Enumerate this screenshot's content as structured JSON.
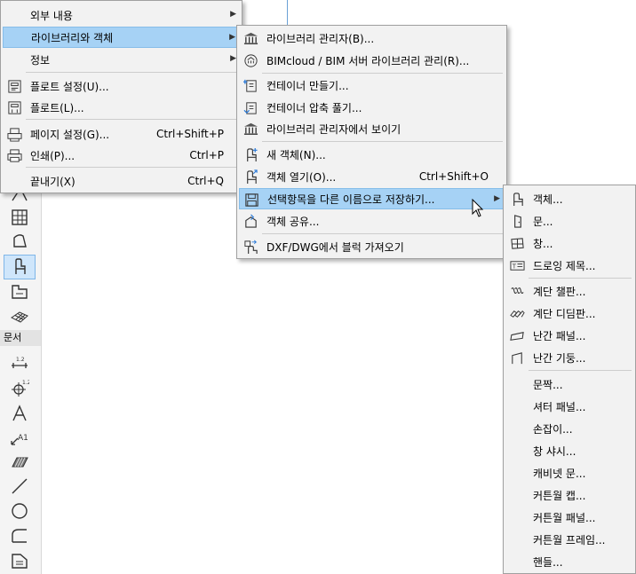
{
  "toolbox": {
    "section_label": "문서",
    "tools": [
      {
        "name": "door-tool-icon"
      },
      {
        "name": "curtain-wall-tool-icon"
      },
      {
        "name": "shell-tool-icon"
      },
      {
        "name": "object-tool-icon",
        "active": true
      },
      {
        "name": "zone-tool-icon"
      },
      {
        "name": "mesh-tool-icon"
      },
      {
        "name": "dimension-tool-icon"
      },
      {
        "name": "level-dimension-tool-icon"
      },
      {
        "name": "text-tool-icon"
      },
      {
        "name": "label-tool-icon"
      },
      {
        "name": "fill-tool-icon"
      },
      {
        "name": "line-tool-icon"
      },
      {
        "name": "circle-tool-icon"
      },
      {
        "name": "polyline-tool-icon"
      },
      {
        "name": "drawing-tool-icon"
      }
    ]
  },
  "file_menu": {
    "items": [
      {
        "label": "외부 내용",
        "submenu": true
      },
      {
        "label": "라이브러리와 객체",
        "submenu": true,
        "highlighted": true
      },
      {
        "label": "정보",
        "submenu": true
      },
      {
        "label": "플로트 설정(U)...",
        "icon": "plot-setup-icon"
      },
      {
        "label": "플로트(L)...",
        "icon": "plot-icon"
      },
      {
        "label": "페이지 설정(G)...",
        "icon": "page-setup-icon",
        "shortcut": "Ctrl+Shift+P"
      },
      {
        "label": "인쇄(P)...",
        "icon": "print-icon",
        "shortcut": "Ctrl+P"
      },
      {
        "label": "끝내기(X)",
        "shortcut": "Ctrl+Q"
      }
    ]
  },
  "library_menu": {
    "items": [
      {
        "label": "라이브러리 관리자(B)...",
        "icon": "library-manager-icon"
      },
      {
        "label": "BIMcloud / BIM 서버 라이브러리 관리(R)...",
        "icon": "bimcloud-library-icon"
      },
      {
        "label": "컨테이너 만들기...",
        "icon": "create-container-icon"
      },
      {
        "label": "컨테이너 압축 풀기...",
        "icon": "extract-container-icon"
      },
      {
        "label": "라이브러리 관리자에서 보이기",
        "icon": "show-in-library-manager-icon"
      },
      {
        "label": "새 객체(N)...",
        "icon": "new-object-icon"
      },
      {
        "label": "객체 열기(O)...",
        "icon": "open-object-icon",
        "shortcut": "Ctrl+Shift+O"
      },
      {
        "label": "선택항목을 다른 이름으로 저장하기...",
        "icon": "save-selection-as-icon",
        "submenu": true,
        "highlighted": true
      },
      {
        "label": "객체 공유...",
        "icon": "share-object-icon"
      },
      {
        "label": "DXF/DWG에서 블럭 가져오기",
        "icon": "import-block-icon"
      }
    ]
  },
  "save_as_menu": {
    "items": [
      {
        "label": "객체...",
        "icon": "object-icon"
      },
      {
        "label": "문...",
        "icon": "door-icon"
      },
      {
        "label": "창...",
        "icon": "window-icon"
      },
      {
        "label": "드로잉 제목...",
        "icon": "drawing-title-icon"
      },
      {
        "label": "계단 챌판...",
        "icon": "stair-riser-icon"
      },
      {
        "label": "계단 디딤판...",
        "icon": "stair-tread-icon"
      },
      {
        "label": "난간 패널...",
        "icon": "railing-panel-icon"
      },
      {
        "label": "난간 기둥...",
        "icon": "railing-post-icon"
      },
      {
        "label": "문짝..."
      },
      {
        "label": "셔터 패널..."
      },
      {
        "label": "손잡이..."
      },
      {
        "label": "창 샤시..."
      },
      {
        "label": "캐비넷 문..."
      },
      {
        "label": "커튼월 캡..."
      },
      {
        "label": "커튼월 패널..."
      },
      {
        "label": "커튼월 프레임..."
      },
      {
        "label": "핸들..."
      }
    ]
  }
}
